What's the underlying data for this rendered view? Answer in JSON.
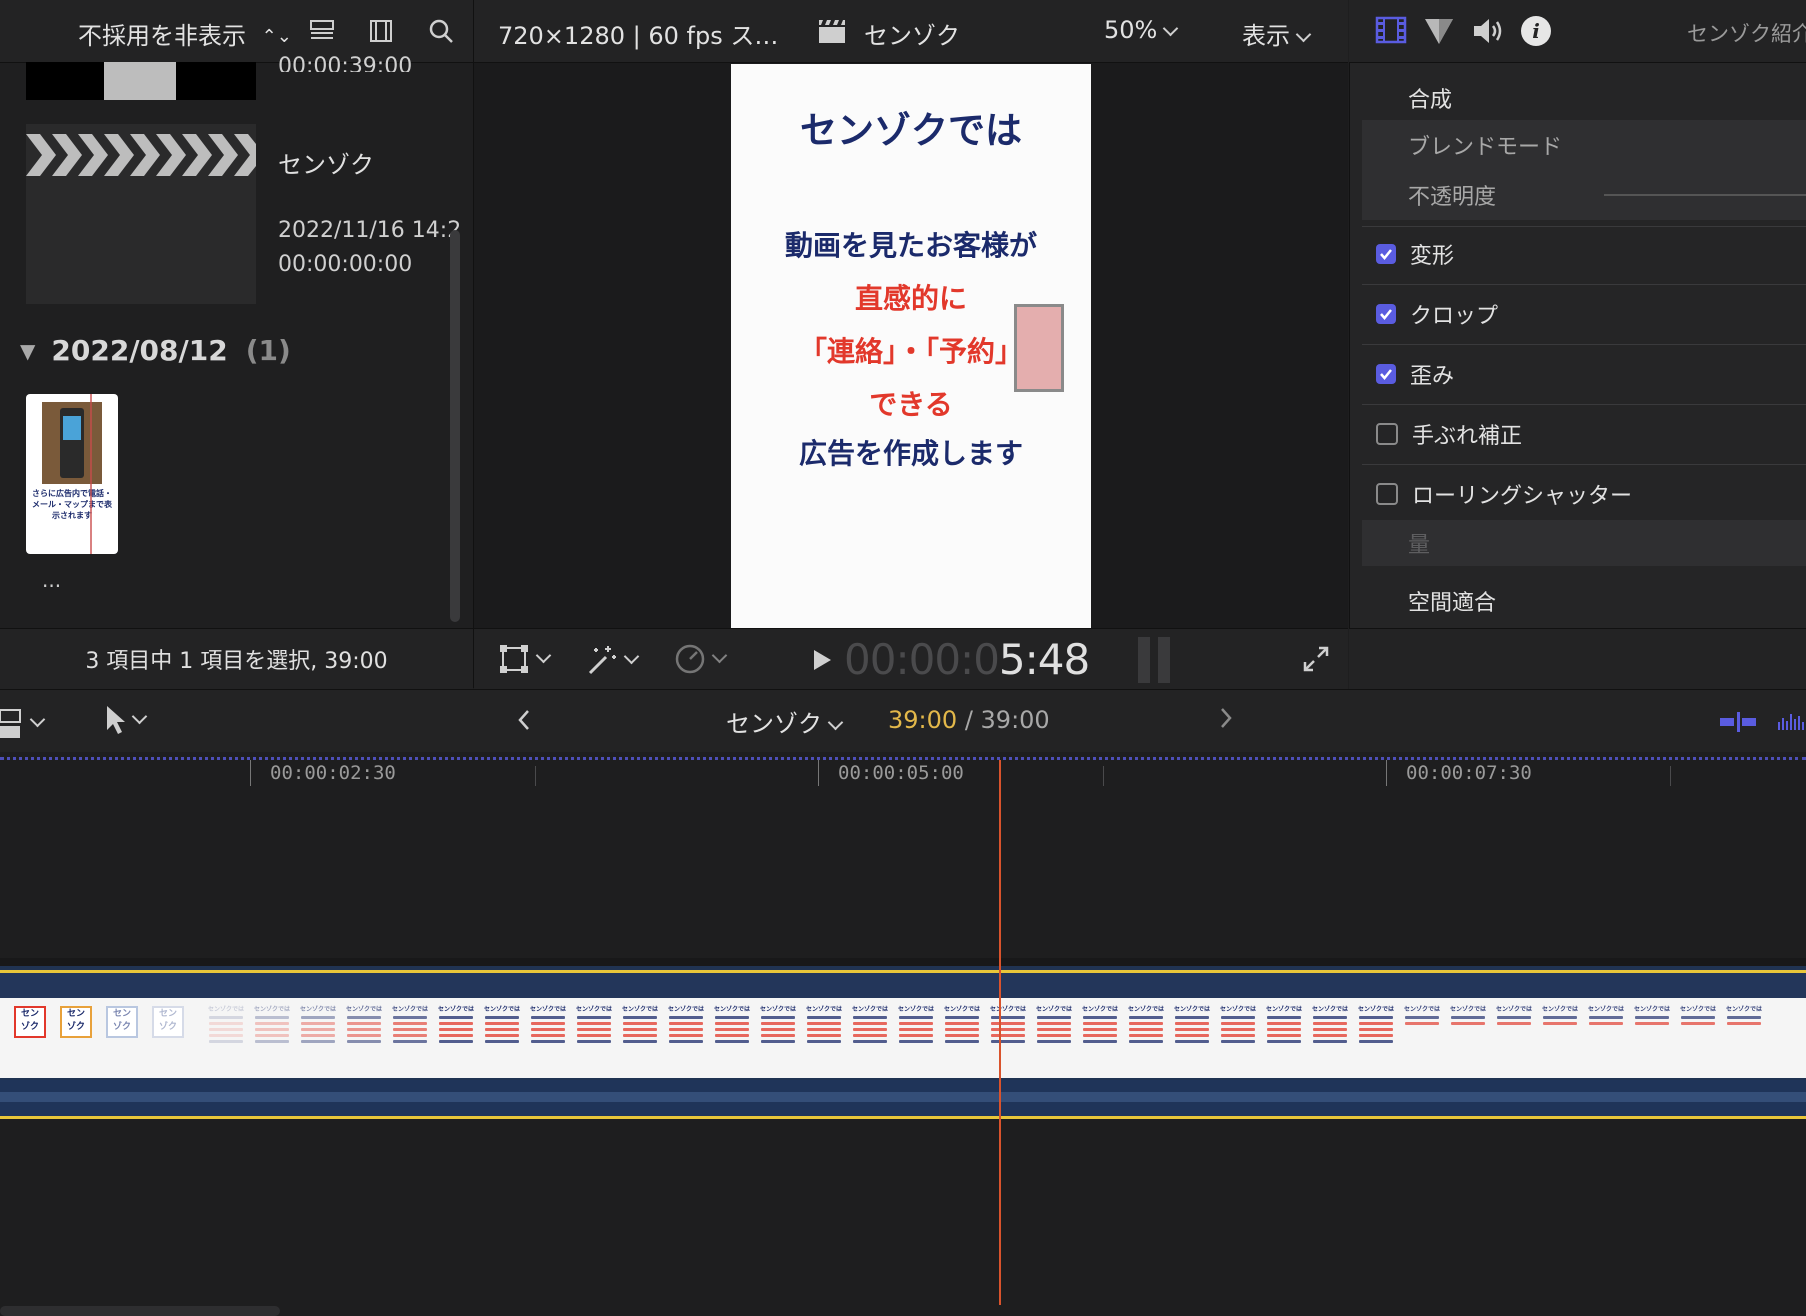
{
  "browser": {
    "filter_label": "不採用を非表示",
    "partial_timecode": "00:00:39:00",
    "clips": [
      {
        "name": "センゾク",
        "date": "2022/11/16 14:2",
        "duration": "00:00:00:00"
      }
    ],
    "group": {
      "date": "2022/08/12",
      "count": "(1)"
    },
    "group_clip_caption": "さらに広告内で電話・メール・マップまで表示されます",
    "more": "...",
    "status": "3 項目中 1 項目を選択, 39:00"
  },
  "viewer": {
    "format": "720×1280 | 60 fps ス…",
    "project_name": "センゾク",
    "zoom": "50%",
    "view_menu": "表示",
    "timecode_dim": "00:00:0",
    "timecode_bright": "5:48",
    "frame_text": {
      "title": "センゾクでは",
      "line1": "動画を見たお客様が",
      "line2": "直感的に",
      "line3": "「連絡」・「予約」",
      "line4": "できる",
      "line5": "広告を作成します"
    }
  },
  "inspector": {
    "title": "センゾク紹介",
    "sections": {
      "compositing": "合成",
      "blend_mode": "ブレンドモード",
      "opacity": "不透明度",
      "transform": "変形",
      "crop": "クロップ",
      "distort": "歪み",
      "stabilization": "手ぶれ補正",
      "rolling_shutter": "ローリングシャッター",
      "amount": "量",
      "spatial_conform": "空間適合"
    },
    "checks": {
      "transform": true,
      "crop": true,
      "distort": true,
      "stabilization": false,
      "rolling_shutter": false
    }
  },
  "timeline": {
    "project_name": "センゾク",
    "position": "39:00",
    "duration": "/ 39:00",
    "ruler": [
      "00:00:02:30",
      "00:00:05:00",
      "00:00:07:30"
    ],
    "thumb_caption": "センゾクでは"
  },
  "colors": {
    "accent_blue": "#5a5ce0",
    "playhead": "#d9532c",
    "clip_border": "#e8c63a",
    "position_text": "#e3b84a",
    "frame_navy": "#1b2a6b",
    "frame_red": "#e2382b"
  }
}
